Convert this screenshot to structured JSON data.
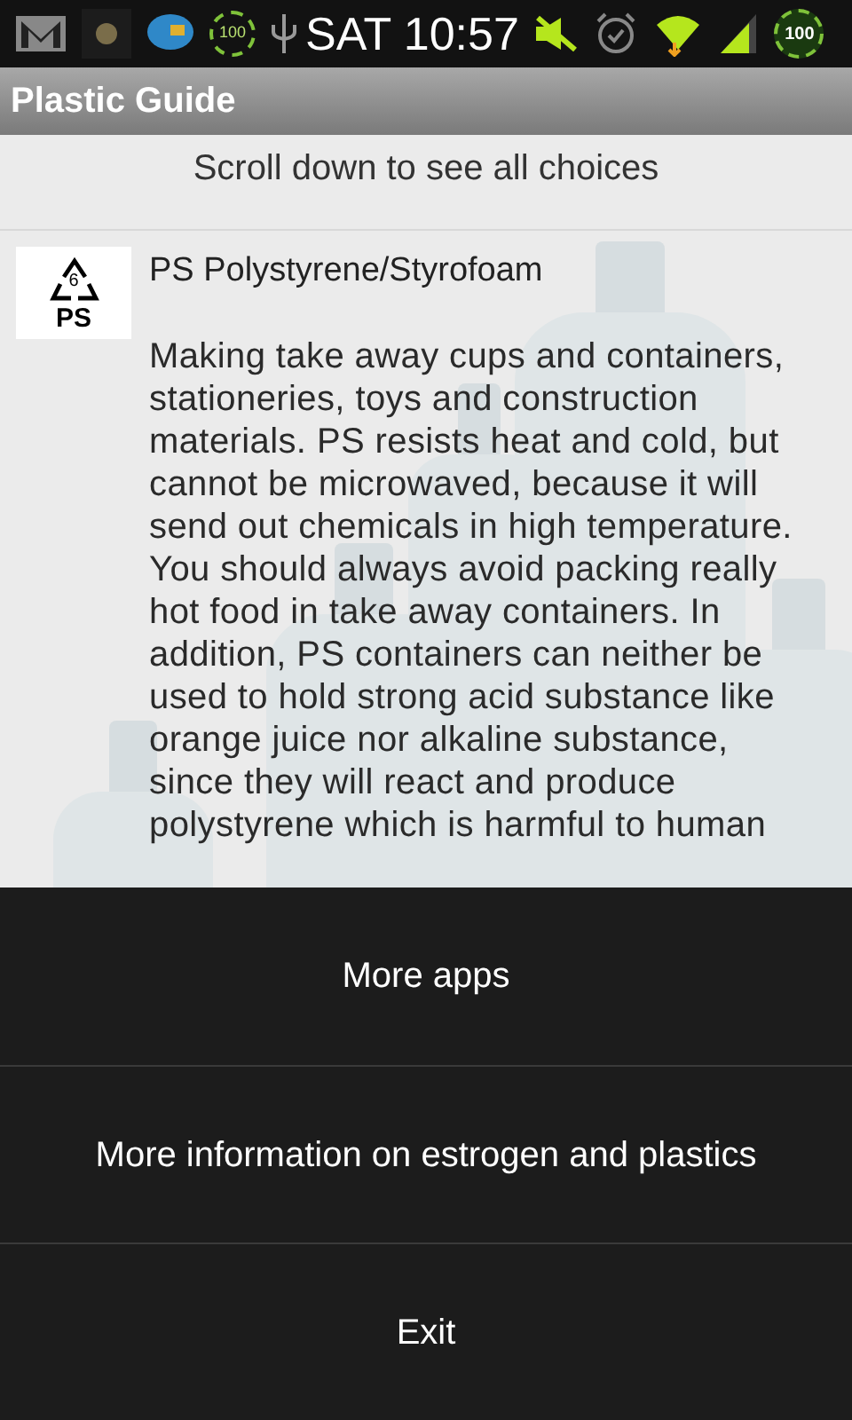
{
  "status_bar": {
    "notification_badge": "100",
    "time": "SAT 10:57",
    "battery_badge": "100"
  },
  "window": {
    "title": "Plastic Guide"
  },
  "hint": "Scroll down to see all choices",
  "plastics": [
    {
      "code": "6",
      "abbreviation": "PS",
      "name": "PS Polystyrene/Styrofoam",
      "description": "Making take away cups and containers, stationeries, toys and construction materials. PS resists heat and cold, but cannot be microwaved, because it will send out chemicals in high temperature. You should always avoid packing really hot food in take away containers. In addition, PS containers can neither be used to hold strong acid substance like orange juice nor alkaline substance, since they will react and produce polystyrene which is harmful to human"
    }
  ],
  "menu": [
    "More apps",
    "More information on estrogen and plastics",
    "Exit"
  ]
}
